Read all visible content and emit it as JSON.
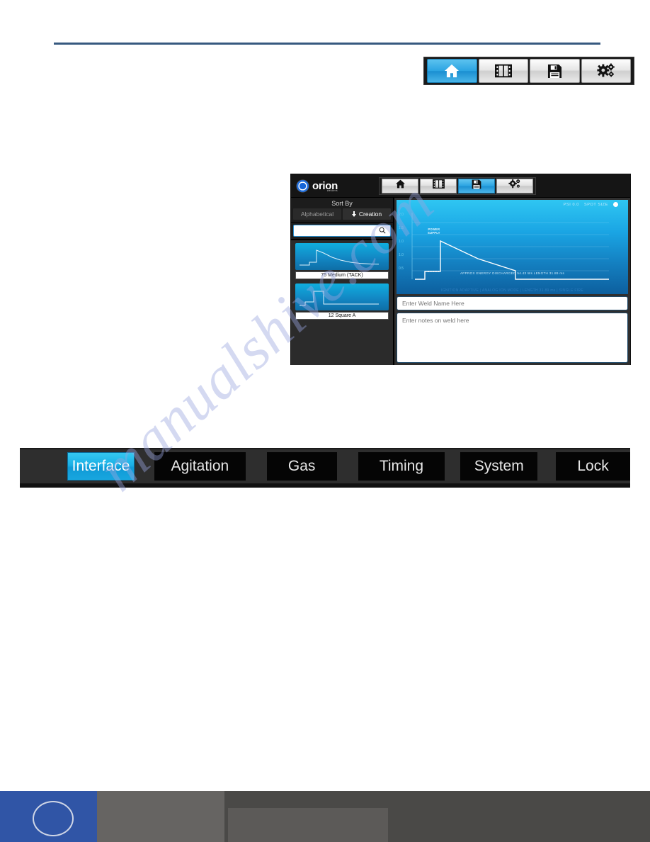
{
  "top_toolbar": {
    "buttons": [
      {
        "name": "home",
        "icon": "home-icon",
        "active": true
      },
      {
        "name": "film",
        "icon": "film-icon",
        "active": false
      },
      {
        "name": "save",
        "icon": "floppy-save-icon",
        "active": false
      },
      {
        "name": "settings",
        "icon": "gears-icon",
        "active": false
      }
    ]
  },
  "device": {
    "brand": {
      "name": "orion",
      "subtext": "welders"
    },
    "nav_buttons": [
      {
        "name": "home",
        "icon": "home-icon",
        "active": false
      },
      {
        "name": "film",
        "icon": "film-icon",
        "active": false
      },
      {
        "name": "save",
        "icon": "floppy-save-icon",
        "active": true
      },
      {
        "name": "settings",
        "icon": "gears-icon",
        "active": false
      }
    ],
    "sidebar": {
      "sort_by_label": "Sort By",
      "sort_alphabetical": "Alphabetical",
      "sort_creation": "Creation",
      "search_value": "",
      "search_placeholder": "",
      "search_icon": "search-icon",
      "weld_items": [
        {
          "label": "75 Medium (TACK)",
          "waveform": "decay"
        },
        {
          "label": "12 Square A",
          "waveform": "square"
        }
      ]
    },
    "graph": {
      "psi_label": "PSI 0.0",
      "spot_size_label": "SPOT SIZE",
      "y_ticks": [
        "2.0",
        "1.5",
        "1.0",
        "1.0",
        "0.5"
      ],
      "power_annotation": "POWER\nSUPPLY",
      "caption_primary": "APPROX ENERGY DISCHARGED 54.43 Ws  LENGTH 31.89 ms",
      "caption_secondary": "IGNITION ADAPTIVE | ANALOG ION MODE | LENGTH 31.89 ms | SINGLE FIRE"
    },
    "weld_name": {
      "value": "",
      "placeholder": "Enter Weld Name Here"
    },
    "weld_notes": {
      "value": "",
      "placeholder": "Enter notes on weld here"
    }
  },
  "settings_tabs": [
    {
      "label": "Interface",
      "active": true
    },
    {
      "label": "Agitation",
      "active": false
    },
    {
      "label": "Gas",
      "active": false
    },
    {
      "label": "Timing",
      "active": false
    },
    {
      "label": "System",
      "active": false
    },
    {
      "label": "Lock",
      "active": false
    }
  ],
  "watermark": {
    "text": "manualshive.com"
  },
  "colors": {
    "accent_blue": "#1ba6e0",
    "rule_blue": "#37597f",
    "footer_blue": "#3055a6",
    "panel_dark": "#2b2b2b"
  }
}
